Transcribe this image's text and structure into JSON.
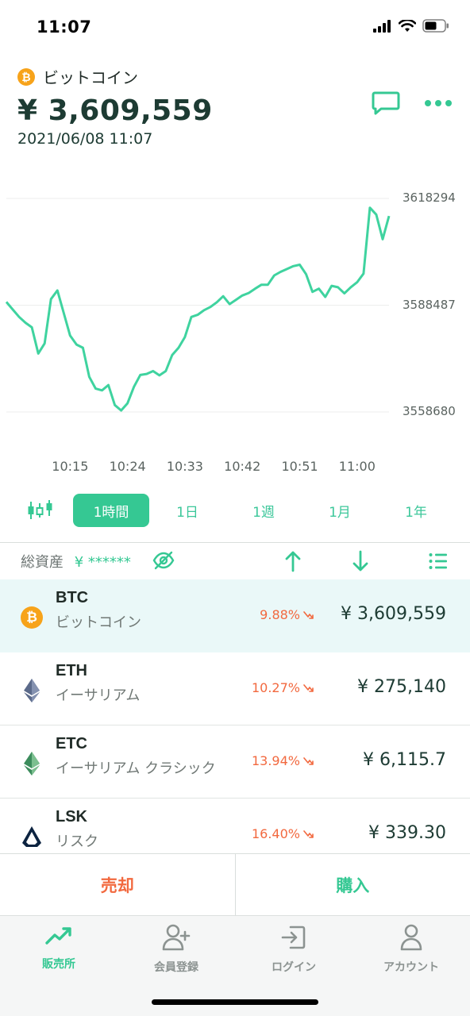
{
  "status_bar": {
    "time": "11:07"
  },
  "coin": {
    "name": "ビットコイン",
    "logo": "₿",
    "price": "¥ 3,609,559",
    "timestamp": "2021/06/08 11:07"
  },
  "chart_data": {
    "type": "line",
    "x_ticks": [
      "10:15",
      "10:24",
      "10:33",
      "10:42",
      "10:51",
      "11:00"
    ],
    "y_ticks": [
      "3618294",
      "3588487",
      "3558680"
    ],
    "ylim": [
      3558680,
      3618294
    ],
    "grid": true,
    "color": "#3fd39f",
    "x_minutes": [
      0,
      1,
      2,
      3,
      4,
      5,
      6,
      7,
      8,
      9,
      10,
      11,
      12,
      13,
      14,
      15,
      16,
      17,
      18,
      19,
      20,
      21,
      22,
      23,
      24,
      25,
      26,
      27,
      28,
      29,
      30,
      31,
      32,
      33,
      34,
      35,
      36,
      37,
      38,
      39,
      40,
      41,
      42,
      43,
      44,
      45,
      46,
      47,
      48,
      49,
      50,
      51,
      52,
      53,
      54,
      55,
      56,
      57,
      58,
      59,
      60
    ],
    "values": [
      3589400,
      3587300,
      3585200,
      3583600,
      3582300,
      3575000,
      3577800,
      3590200,
      3592600,
      3586300,
      3580000,
      3577500,
      3576600,
      3568500,
      3565200,
      3564700,
      3566200,
      3560600,
      3559100,
      3561100,
      3565700,
      3569000,
      3569300,
      3570100,
      3568900,
      3570100,
      3574600,
      3576600,
      3579600,
      3585200,
      3585800,
      3587100,
      3588000,
      3589300,
      3591000,
      3588800,
      3590000,
      3591200,
      3591900,
      3593100,
      3594200,
      3594200,
      3596800,
      3597800,
      3598600,
      3599400,
      3599800,
      3597100,
      3592200,
      3593100,
      3590800,
      3593900,
      3593500,
      3591800,
      3593500,
      3594900,
      3597300,
      3615700,
      3613800,
      3606900,
      3613400
    ]
  },
  "range_tabs": [
    {
      "label": "1時間",
      "active": true
    },
    {
      "label": "1日",
      "active": false
    },
    {
      "label": "1週",
      "active": false
    },
    {
      "label": "1月",
      "active": false
    },
    {
      "label": "1年",
      "active": false
    }
  ],
  "assets": {
    "label": "総資産",
    "value": "¥ ******"
  },
  "coins": [
    {
      "symbol": "BTC",
      "name": "ビットコイン",
      "change": "9.88%",
      "price": "¥ 3,609,559"
    },
    {
      "symbol": "ETH",
      "name": "イーサリアム",
      "change": "10.27%",
      "price": "¥ 275,140"
    },
    {
      "symbol": "ETC",
      "name": "イーサリアム クラシック",
      "change": "13.94%",
      "price": "¥ 6,115.7"
    },
    {
      "symbol": "LSK",
      "name": "リスク",
      "change": "16.40%",
      "price": "¥ 339.30"
    }
  ],
  "actions": {
    "sell": "売却",
    "buy": "購入"
  },
  "tabs": [
    {
      "label": "販売所",
      "icon": "trending-up-icon",
      "active": true
    },
    {
      "label": "会員登録",
      "icon": "add-user-icon",
      "active": false
    },
    {
      "label": "ログイン",
      "icon": "login-icon",
      "active": false
    },
    {
      "label": "アカウント",
      "icon": "account-icon",
      "active": false
    }
  ],
  "colors": {
    "accent": "#35c893",
    "down": "#f2693f",
    "price_text": "#1d3b33"
  }
}
